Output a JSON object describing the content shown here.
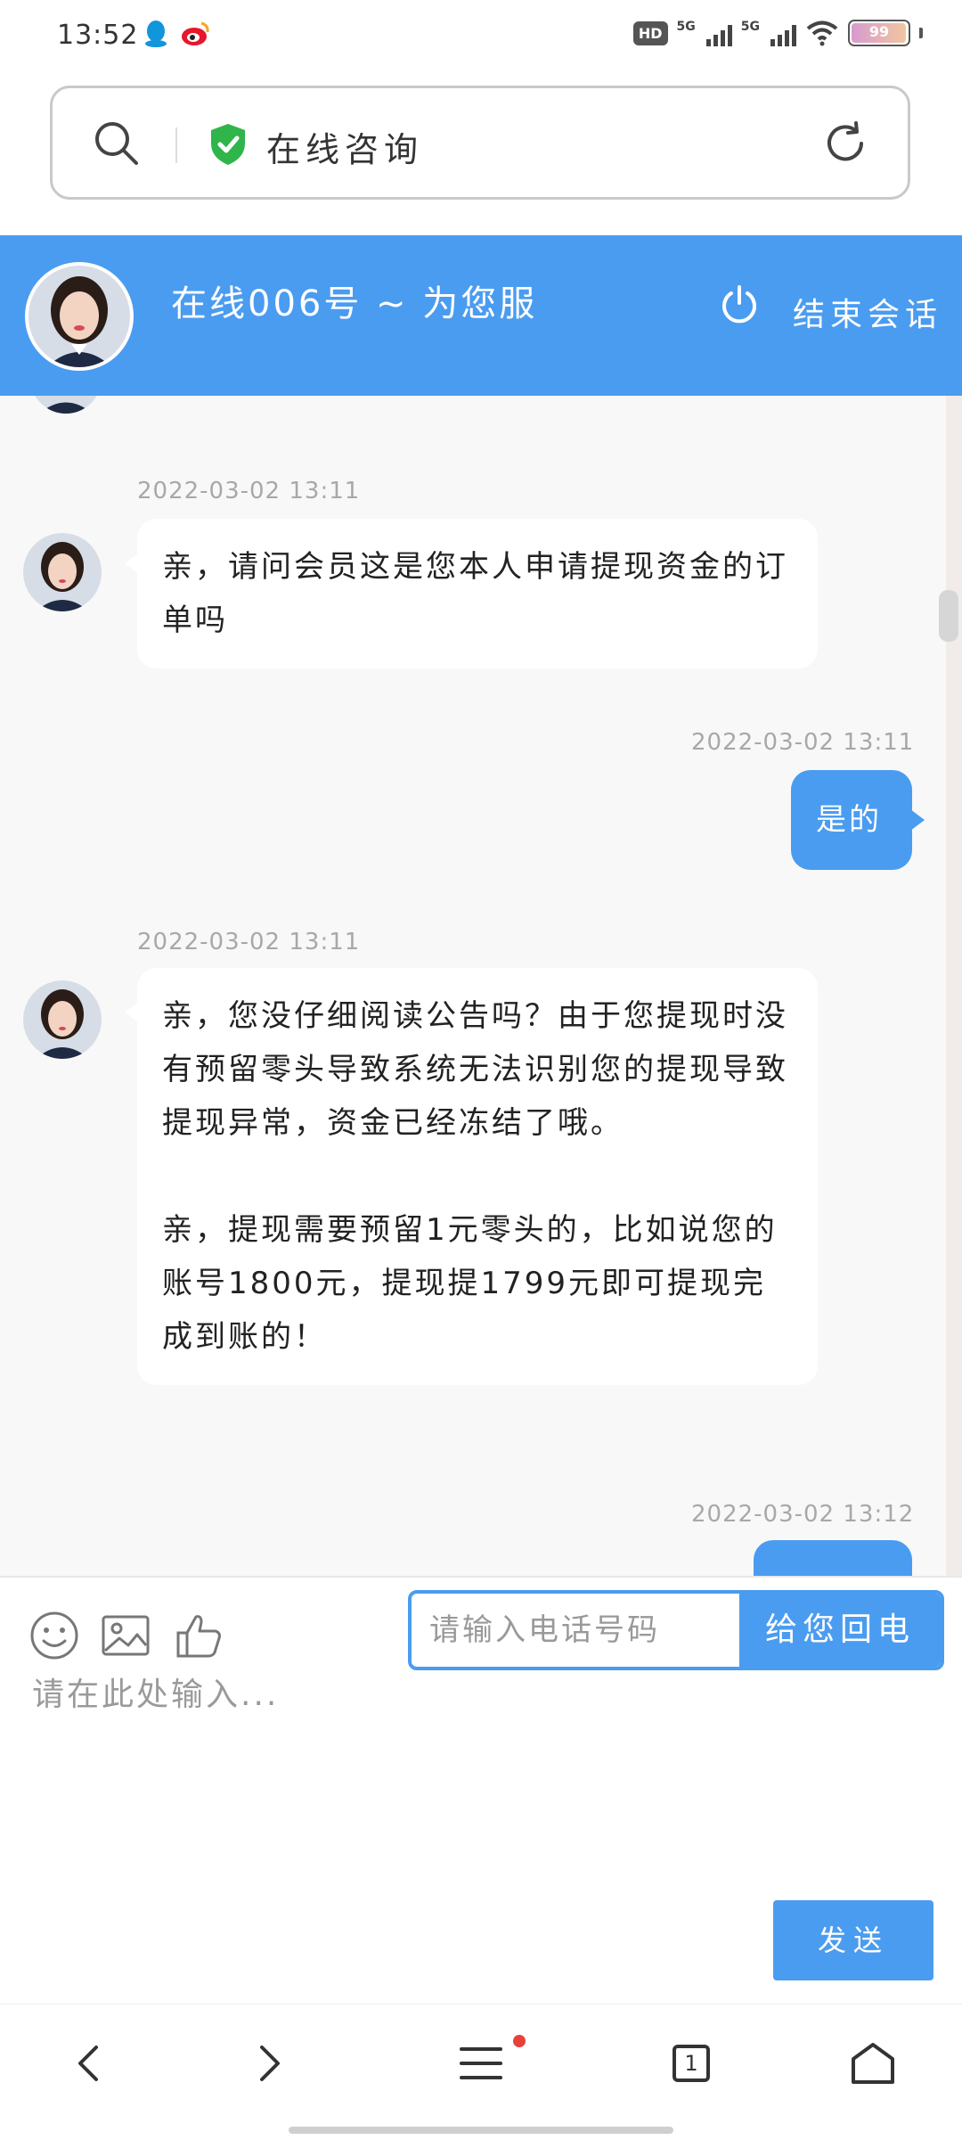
{
  "status_bar": {
    "time": "13:52",
    "left_icons": [
      "qq-icon",
      "weibo-icon"
    ],
    "hd_label": "HD",
    "network_labels": [
      "5G",
      "5G"
    ],
    "battery_percent": 99,
    "battery_label": "99"
  },
  "address_bar": {
    "title": "在线咨询"
  },
  "chat_header": {
    "title": "在线006号 ~ 为您服",
    "end_button": "结束会话"
  },
  "messages": [
    {
      "time": "2022-03-02 13:11",
      "from": "agent",
      "paragraphs": [
        "亲，请问会员这是您本人申请提现资金的订单吗"
      ]
    },
    {
      "time": "2022-03-02 13:11",
      "from": "user",
      "text": "是的"
    },
    {
      "time": "2022-03-02 13:11",
      "from": "agent",
      "paragraphs": [
        "亲，您没仔细阅读公告吗？由于您提现时没有预留零头导致系统无法识别您的提现导致提现异常，资金已经冻结了哦。",
        "亲，提现需要预留1元零头的，比如说您的账号1800元，提现提1799元即可提现完成到账的！"
      ]
    },
    {
      "time": "2022-03-02 13:12",
      "from": "user",
      "text": ""
    }
  ],
  "input_area": {
    "toolbar_icons": [
      "emoji-icon",
      "image-icon",
      "thumbs-up-icon"
    ],
    "phone_placeholder": "请输入电话号码",
    "callback_button": "给您回电",
    "message_placeholder": "请在此处输入...",
    "send_button": "发送"
  },
  "nav_bar": {
    "tab_count": "1",
    "icons": [
      "back-icon",
      "forward-icon",
      "menu-icon",
      "tabs-icon",
      "home-icon"
    ]
  },
  "colors": {
    "accent": "#4a9cf0",
    "chat_bg": "#f8f8f8",
    "notification_dot": "#e8403a",
    "shield_green": "#2fb54a"
  }
}
